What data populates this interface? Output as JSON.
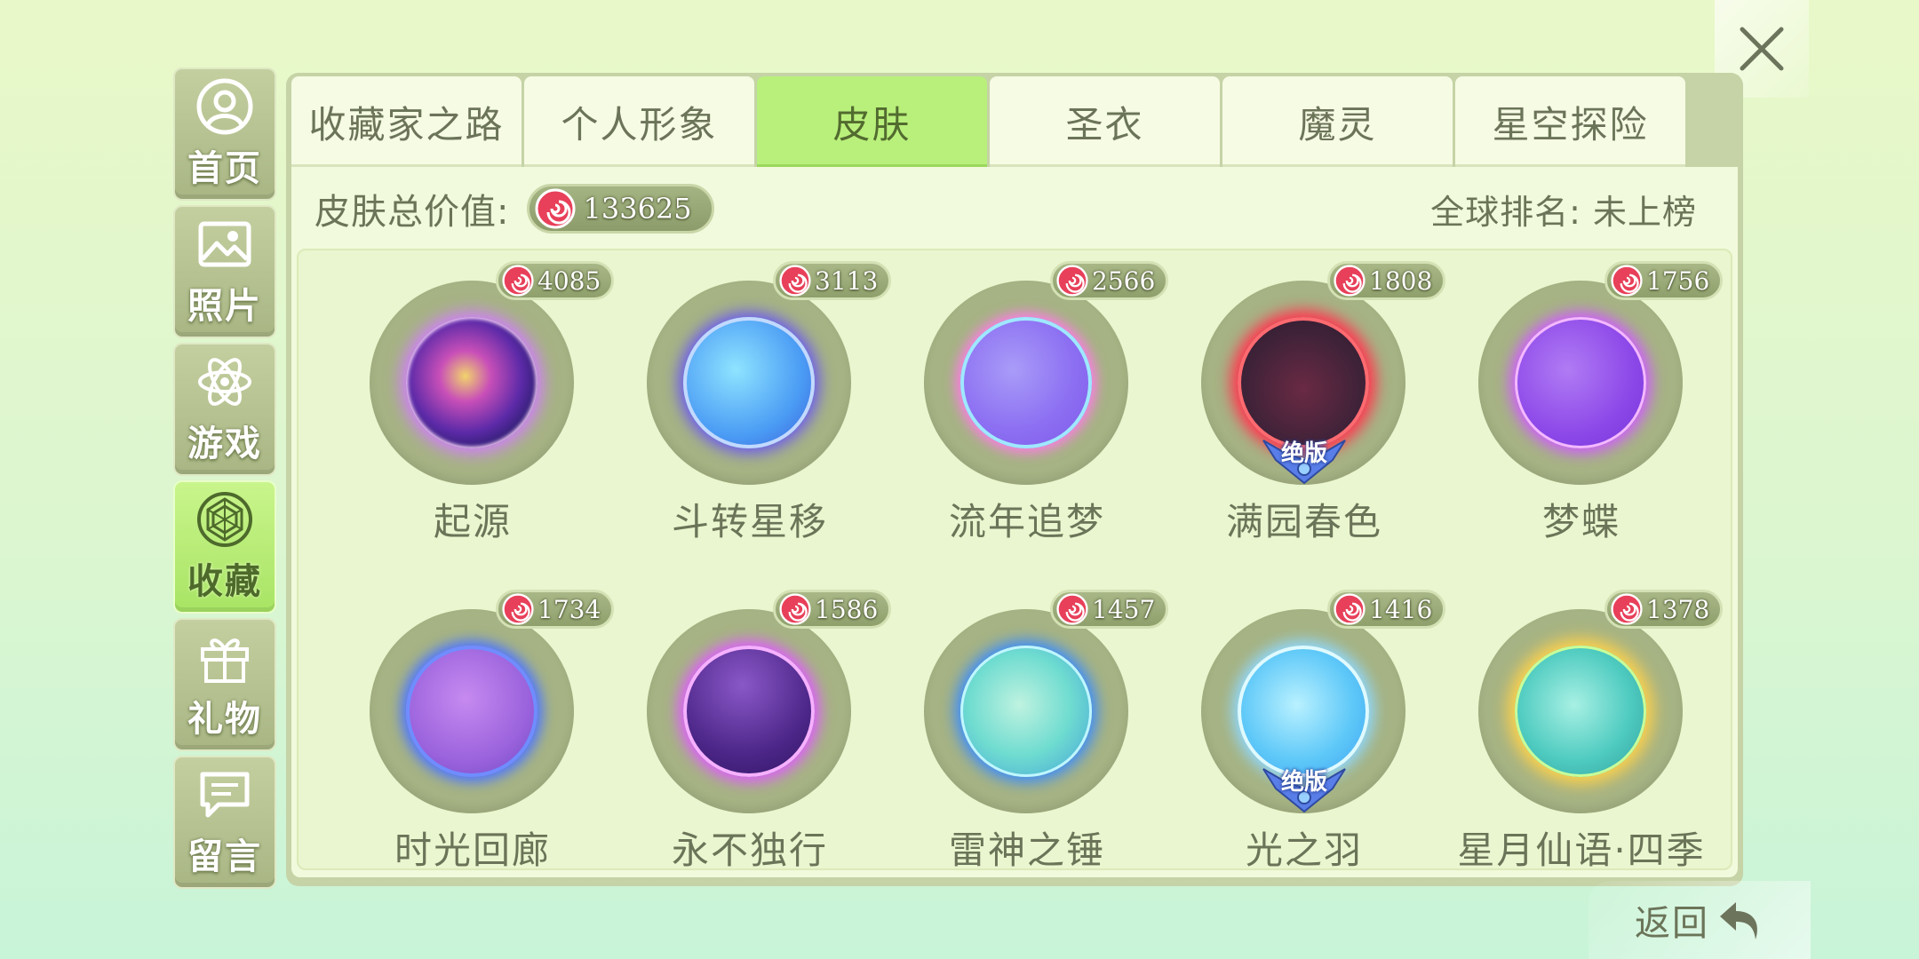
{
  "close": {
    "icon": "close-icon"
  },
  "sidebar": {
    "items": [
      {
        "label": "首页",
        "icon": "user-circle-icon",
        "active": false
      },
      {
        "label": "照片",
        "icon": "photo-icon",
        "active": false
      },
      {
        "label": "游戏",
        "icon": "atom-icon",
        "active": false
      },
      {
        "label": "收藏",
        "icon": "diamond-icon",
        "active": true
      },
      {
        "label": "礼物",
        "icon": "gift-icon",
        "active": false
      },
      {
        "label": "留言",
        "icon": "message-icon",
        "active": false
      }
    ]
  },
  "tabs": [
    {
      "label": "收藏家之路",
      "active": false
    },
    {
      "label": "个人形象",
      "active": false
    },
    {
      "label": "皮肤",
      "active": true
    },
    {
      "label": "圣衣",
      "active": false
    },
    {
      "label": "魔灵",
      "active": false
    },
    {
      "label": "星空探险",
      "active": false
    }
  ],
  "summary": {
    "label": "皮肤总价值:",
    "total": "133625",
    "rank": "全球排名: 未上榜"
  },
  "skins": [
    {
      "name": "起源",
      "price": "4085",
      "badge": ""
    },
    {
      "name": "斗转星移",
      "price": "3113",
      "badge": ""
    },
    {
      "name": "流年追梦",
      "price": "2566",
      "badge": ""
    },
    {
      "name": "满园春色",
      "price": "1808",
      "badge": "绝版"
    },
    {
      "name": "梦蝶",
      "price": "1756",
      "badge": ""
    },
    {
      "name": "时光回廊",
      "price": "1734",
      "badge": ""
    },
    {
      "name": "永不独行",
      "price": "1586",
      "badge": ""
    },
    {
      "name": "雷神之锤",
      "price": "1457",
      "badge": ""
    },
    {
      "name": "光之羽",
      "price": "1416",
      "badge": "绝版"
    },
    {
      "name": "星月仙语·四季",
      "price": "1378",
      "badge": ""
    }
  ],
  "back": {
    "label": "返回",
    "icon": "return-arrow-icon"
  },
  "colors": {
    "active_tab": "#b9f07c",
    "panel": "#c5d3a6",
    "coin": "#e8405a"
  }
}
